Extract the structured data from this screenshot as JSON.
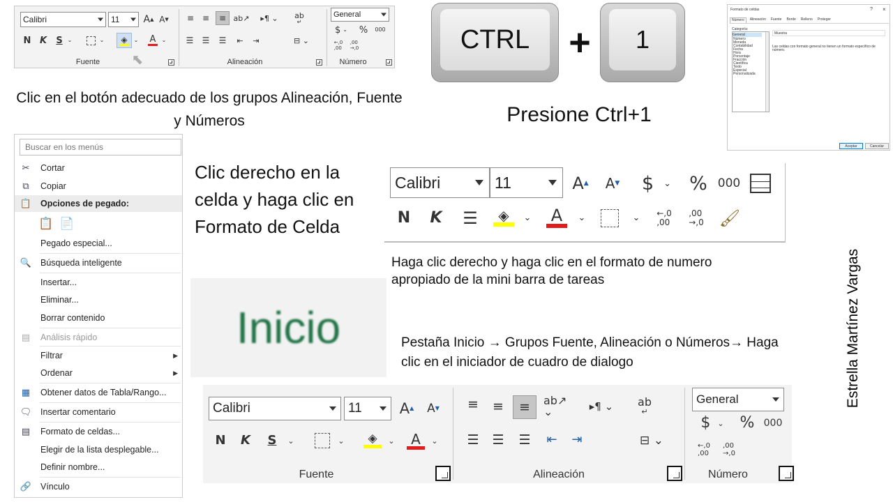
{
  "top_ribbon": {
    "font_name": "Calibri",
    "font_size": "11",
    "bold": "N",
    "italic": "K",
    "underline": "S",
    "font_grow": "A",
    "font_shrink": "A",
    "font_color_letter": "A",
    "wrap_icon": "ab",
    "number_format": "General",
    "currency": "$",
    "percent": "%",
    "thousands": "000",
    "group_labels": [
      "Fuente",
      "Alineación",
      "Número"
    ]
  },
  "captions": {
    "ribbon_buttons": "Clic en el botón adecuado de los grupos Alineación, Fuente y Números",
    "shortcut": "Presione Ctrl+1",
    "context_menu": "Clic derecho en la celda y haga clic en Formato de Celda",
    "mini_toolbar": "Haga clic derecho y haga clic en el formato de numero apropiado de la mini barra de tareas",
    "home_tab": "Pestaña Inicio → Grupos Fuente, Alineación o Números→ Haga clic en el iniciador de cuadro de dialogo"
  },
  "keys": {
    "ctrl": "CTRL",
    "plus": "+",
    "one": "1"
  },
  "dialog": {
    "title": "Formato de celdas",
    "title_controls": "?",
    "close": "×",
    "tabs": [
      "Número",
      "Alineación",
      "Fuente",
      "Borde",
      "Relleno",
      "Proteger"
    ],
    "category_label": "Categoría:",
    "categories": [
      "General",
      "Número",
      "Moneda",
      "Contabilidad",
      "Fecha",
      "Hora",
      "Porcentaje",
      "Fracción",
      "Científica",
      "Texto",
      "Especial",
      "Personalizada"
    ],
    "sample_label": "Muestra",
    "description": "Las celdas con formato general no tienen un formato específico de número.",
    "ok": "Aceptar",
    "cancel": "Cancelar"
  },
  "context_menu": {
    "search_placeholder": "Buscar en los menús",
    "items": [
      {
        "label": "Cortar",
        "icon": "scissors-icon"
      },
      {
        "label": "Copiar",
        "icon": "copy-icon"
      },
      {
        "label": "Opciones de pegado:",
        "icon": "paste-icon"
      },
      {
        "label": "Pegado especial...",
        "icon": ""
      },
      {
        "label": "Búsqueda inteligente",
        "icon": "smart-lookup-icon"
      },
      {
        "label": "Insertar...",
        "icon": ""
      },
      {
        "label": "Eliminar...",
        "icon": ""
      },
      {
        "label": "Borrar contenido",
        "icon": ""
      },
      {
        "label": "Análisis rápido",
        "icon": "quick-analysis-icon"
      },
      {
        "label": "Filtrar",
        "icon": ""
      },
      {
        "label": "Ordenar",
        "icon": ""
      },
      {
        "label": "Obtener datos de Tabla/Rango...",
        "icon": "table-icon"
      },
      {
        "label": "Insertar comentario",
        "icon": "comment-icon"
      },
      {
        "label": "Formato de celdas...",
        "icon": "format-cells-icon"
      },
      {
        "label": "Elegir de la lista desplegable...",
        "icon": ""
      },
      {
        "label": "Definir nombre...",
        "icon": ""
      },
      {
        "label": "Vínculo",
        "icon": "link-icon"
      }
    ]
  },
  "mini_toolbar": {
    "font_name": "Calibri",
    "font_size": "11",
    "bold": "N",
    "italic": "K",
    "currency": "$",
    "percent": "%",
    "thousands": "000",
    "font_color_letter": "A"
  },
  "inicio": {
    "label": "Inicio",
    "color": "#217346"
  },
  "bottom_ribbon": {
    "font_name": "Calibri",
    "font_size": "11",
    "bold": "N",
    "italic": "K",
    "underline": "S",
    "font_color_letter": "A",
    "wrap_icon": "ab",
    "number_format": "General",
    "currency": "$",
    "percent": "%",
    "thousands": "000",
    "group_labels": [
      "Fuente",
      "Alineación",
      "Número"
    ]
  },
  "author": "Estrella Martínez Vargas",
  "colors": {
    "highlight_yellow": "#ffff00",
    "font_red": "#e21b1b",
    "excel_green": "#217346"
  }
}
